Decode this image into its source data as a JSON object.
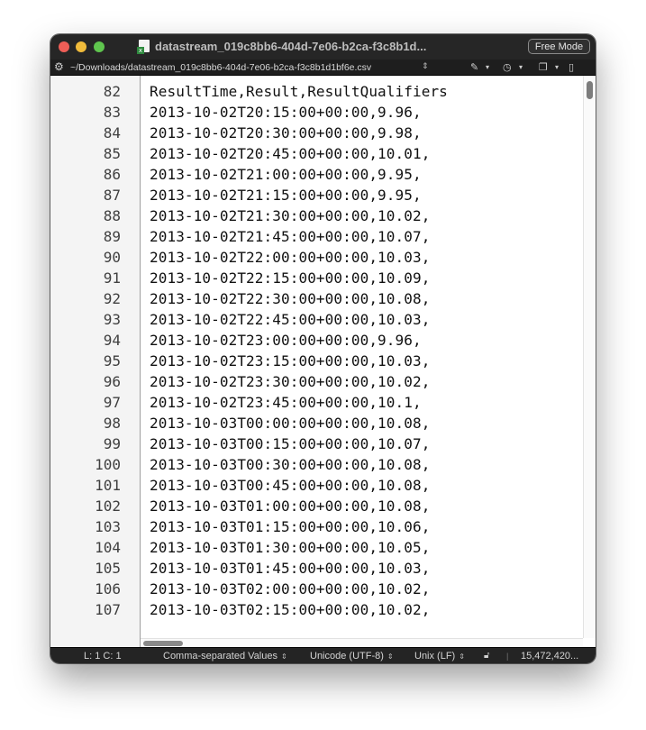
{
  "window": {
    "title": "datastream_019c8bb6-404d-7e06-b2ca-f3c8b1d...",
    "mode_button": "Free Mode"
  },
  "pathbar": {
    "path": "~/Downloads/datastream_019c8bb6-404d-7e06-b2ca-f3c8b1d1bf6e.csv"
  },
  "editor": {
    "lines": [
      {
        "num": "82",
        "text": "ResultTime,Result,ResultQualifiers"
      },
      {
        "num": "83",
        "text": "2013-10-02T20:15:00+00:00,9.96,"
      },
      {
        "num": "84",
        "text": "2013-10-02T20:30:00+00:00,9.98,"
      },
      {
        "num": "85",
        "text": "2013-10-02T20:45:00+00:00,10.01,"
      },
      {
        "num": "86",
        "text": "2013-10-02T21:00:00+00:00,9.95,"
      },
      {
        "num": "87",
        "text": "2013-10-02T21:15:00+00:00,9.95,"
      },
      {
        "num": "88",
        "text": "2013-10-02T21:30:00+00:00,10.02,"
      },
      {
        "num": "89",
        "text": "2013-10-02T21:45:00+00:00,10.07,"
      },
      {
        "num": "90",
        "text": "2013-10-02T22:00:00+00:00,10.03,"
      },
      {
        "num": "91",
        "text": "2013-10-02T22:15:00+00:00,10.09,"
      },
      {
        "num": "92",
        "text": "2013-10-02T22:30:00+00:00,10.08,"
      },
      {
        "num": "93",
        "text": "2013-10-02T22:45:00+00:00,10.03,"
      },
      {
        "num": "94",
        "text": "2013-10-02T23:00:00+00:00,9.96,"
      },
      {
        "num": "95",
        "text": "2013-10-02T23:15:00+00:00,10.03,"
      },
      {
        "num": "96",
        "text": "2013-10-02T23:30:00+00:00,10.02,"
      },
      {
        "num": "97",
        "text": "2013-10-02T23:45:00+00:00,10.1,"
      },
      {
        "num": "98",
        "text": "2013-10-03T00:00:00+00:00,10.08,"
      },
      {
        "num": "99",
        "text": "2013-10-03T00:15:00+00:00,10.07,"
      },
      {
        "num": "100",
        "text": "2013-10-03T00:30:00+00:00,10.08,"
      },
      {
        "num": "101",
        "text": "2013-10-03T00:45:00+00:00,10.08,"
      },
      {
        "num": "102",
        "text": "2013-10-03T01:00:00+00:00,10.08,"
      },
      {
        "num": "103",
        "text": "2013-10-03T01:15:00+00:00,10.06,"
      },
      {
        "num": "104",
        "text": "2013-10-03T01:30:00+00:00,10.05,"
      },
      {
        "num": "105",
        "text": "2013-10-03T01:45:00+00:00,10.03,"
      },
      {
        "num": "106",
        "text": "2013-10-03T02:00:00+00:00,10.02,"
      },
      {
        "num": "107",
        "text": "2013-10-03T02:15:00+00:00,10.02,"
      }
    ]
  },
  "statusbar": {
    "cursor": "L: 1 C: 1",
    "syntax": "Comma-separated Values",
    "encoding": "Unicode (UTF-8)",
    "line_endings": "Unix (LF)",
    "file_size": "15,472,420..."
  },
  "icons": {
    "gear": "gear-icon",
    "pin": "pin-icon",
    "history": "history-icon",
    "copy": "copy-icon",
    "document": "document-icon",
    "lock": "unlock-icon"
  },
  "colors": {
    "close": "#ee5e57",
    "minimize": "#f0bb3b",
    "zoom": "#5fc54e",
    "titlebar": "#262626",
    "gutter": "#f4f4f4"
  }
}
